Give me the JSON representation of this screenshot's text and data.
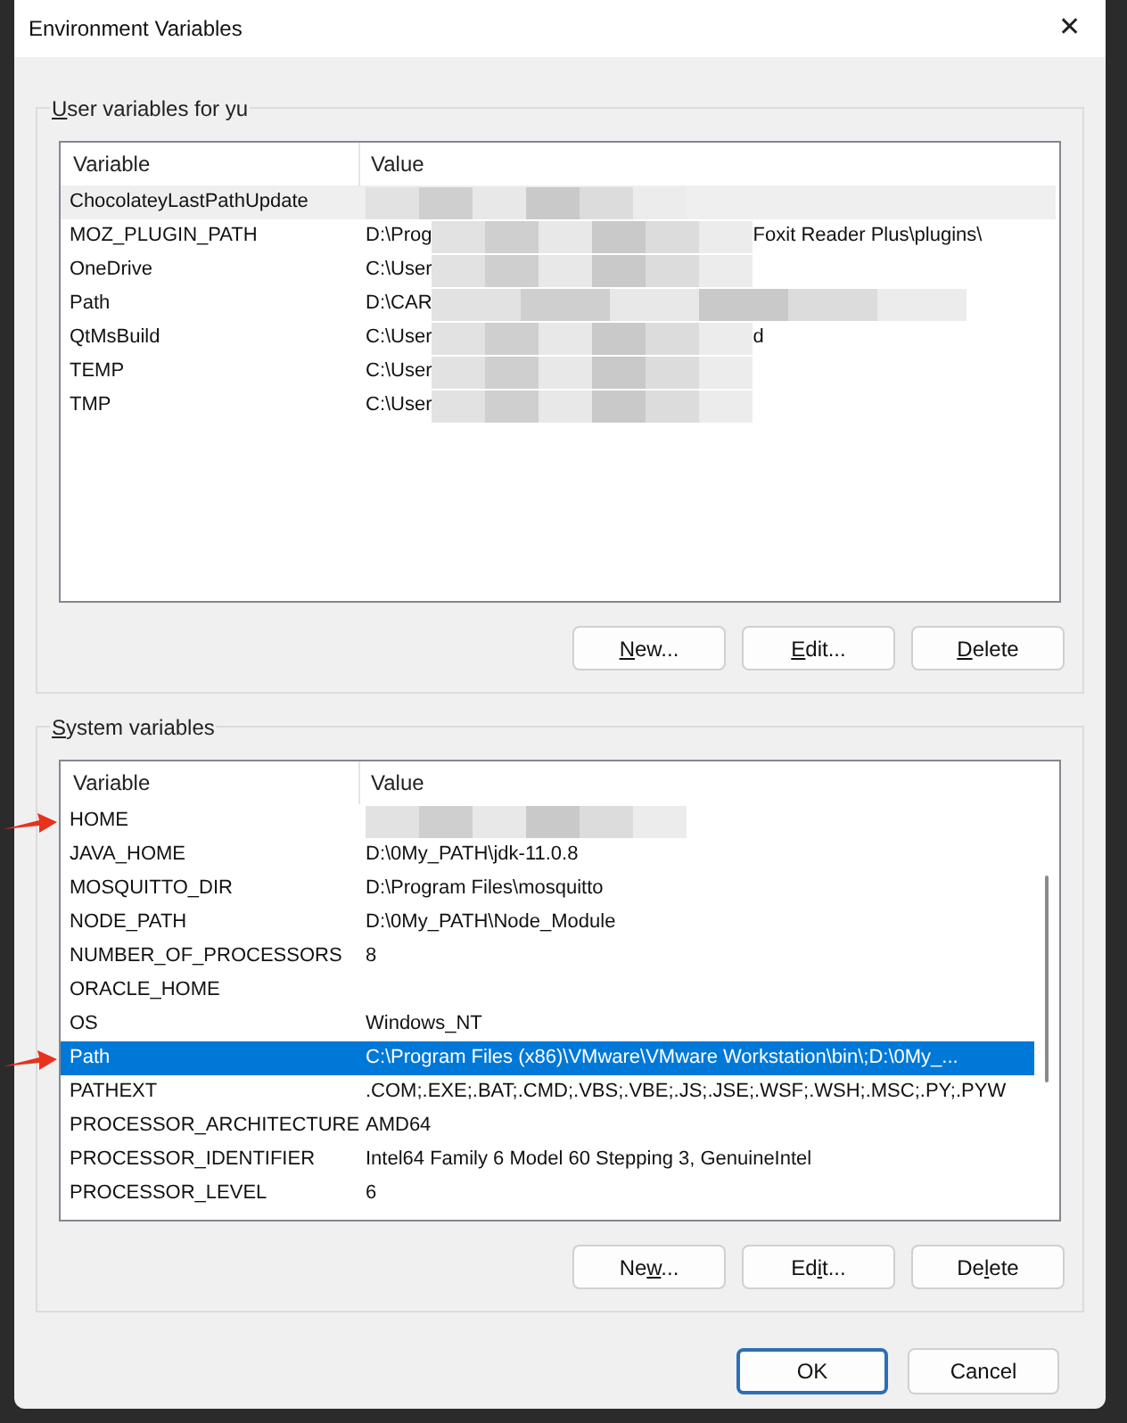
{
  "window": {
    "title": "Environment Variables",
    "close": "✕"
  },
  "user_group": {
    "label": {
      "key": "U",
      "after": "ser variables for yu"
    },
    "columns": [
      "Variable",
      "Value"
    ],
    "rows": [
      {
        "name": "ChocolateyLastPathUpdate",
        "redacted": true,
        "hovered": true,
        "selected": false
      },
      {
        "name": "MOZ_PLUGIN_PATH",
        "value": "D:\\Prog",
        "redacted": true,
        "value_tail": "Foxit Reader Plus\\plugins\\",
        "hovered": false,
        "selected": false
      },
      {
        "name": "OneDrive",
        "value": "C:\\User",
        "redacted": true,
        "hovered": false,
        "selected": false
      },
      {
        "name": "Path",
        "value": "D:\\CAR",
        "redacted": true,
        "hovered": false,
        "selected": false
      },
      {
        "name": "QtMsBuild",
        "value": "C:\\User",
        "redacted": true,
        "value_tail": "d",
        "hovered": false,
        "selected": false
      },
      {
        "name": "TEMP",
        "value": "C:\\User",
        "redacted": true,
        "hovered": false,
        "selected": false
      },
      {
        "name": "TMP",
        "value": "C:\\User",
        "redacted": true,
        "hovered": false,
        "selected": false
      }
    ],
    "buttons": [
      {
        "key": "N",
        "after": "ew..."
      },
      {
        "key": "E",
        "after": "dit..."
      },
      {
        "key": "D",
        "after": "elete"
      }
    ]
  },
  "system_group": {
    "label": {
      "key": "S",
      "after": "ystem variables"
    },
    "columns": [
      "Variable",
      "Value"
    ],
    "rows": [
      {
        "name": "HOME",
        "redacted": true,
        "selected": false,
        "annotated": true
      },
      {
        "name": "JAVA_HOME",
        "value": "D:\\0My_PATH\\jdk-11.0.8",
        "redacted": false,
        "selected": false,
        "annotated": false
      },
      {
        "name": "MOSQUITTO_DIR",
        "value": "D:\\Program Files\\mosquitto",
        "redacted": false,
        "selected": false,
        "annotated": false
      },
      {
        "name": "NODE_PATH",
        "value": "D:\\0My_PATH\\Node_Module",
        "redacted": false,
        "selected": false,
        "annotated": false
      },
      {
        "name": "NUMBER_OF_PROCESSORS",
        "value": "8",
        "redacted": false,
        "selected": false,
        "annotated": false
      },
      {
        "name": "ORACLE_HOME",
        "redacted": false,
        "selected": false,
        "annotated": false
      },
      {
        "name": "OS",
        "value": "Windows_NT",
        "redacted": false,
        "selected": false,
        "annotated": false
      },
      {
        "name": "Path",
        "value": "C:\\Program Files (x86)\\VMware\\VMware Workstation\\bin\\;D:\\0My_...",
        "redacted": false,
        "selected": true,
        "annotated": true
      },
      {
        "name": "PATHEXT",
        "value": ".COM;.EXE;.BAT;.CMD;.VBS;.VBE;.JS;.JSE;.WSF;.WSH;.MSC;.PY;.PYW",
        "redacted": false,
        "selected": false,
        "annotated": false
      },
      {
        "name": "PROCESSOR_ARCHITECTURE",
        "value": "AMD64",
        "redacted": false,
        "selected": false,
        "annotated": false
      },
      {
        "name": "PROCESSOR_IDENTIFIER",
        "value": "Intel64 Family 6 Model 60 Stepping 3, GenuineIntel",
        "redacted": false,
        "selected": false,
        "annotated": false
      },
      {
        "name": "PROCESSOR_LEVEL",
        "value": "6",
        "redacted": false,
        "selected": false,
        "annotated": false
      }
    ],
    "buttons": [
      {
        "before": "Ne",
        "key": "w",
        "after": "..."
      },
      {
        "before": "Ed",
        "key": "i",
        "after": "t..."
      },
      {
        "before": "De",
        "key": "l",
        "after": "ete"
      }
    ]
  },
  "footer_buttons": [
    {
      "label": "OK",
      "default": true
    },
    {
      "label": "Cancel",
      "default": false
    }
  ]
}
